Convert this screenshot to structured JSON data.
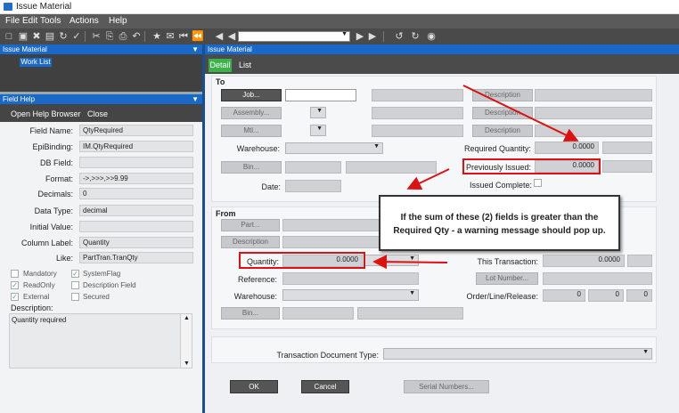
{
  "window": {
    "title": "Issue Material"
  },
  "menu": [
    "File",
    "Edit",
    "Tools",
    "Actions",
    "Help"
  ],
  "panels": {
    "tree_title": "Issue Material",
    "tree_item": "Work List",
    "field_help_title": "Field Help",
    "open_help": "Open Help Browser",
    "close": "Close",
    "right_title": "Issue Material"
  },
  "field_help": {
    "rows": [
      {
        "label": "Field Name:",
        "value": "QtyRequired"
      },
      {
        "label": "EpiBinding:",
        "value": "IM.QtyRequired"
      },
      {
        "label": "DB Field:",
        "value": ""
      },
      {
        "label": "Format:",
        "value": "->,>>>,>>9.99"
      },
      {
        "label": "Decimals:",
        "value": "0"
      },
      {
        "label": "Data Type:",
        "value": "decimal"
      },
      {
        "label": "Initial Value:",
        "value": ""
      },
      {
        "label": "Column Label:",
        "value": "Quantity"
      },
      {
        "label": "Like:",
        "value": "PartTran.TranQty"
      }
    ],
    "checks": [
      {
        "label": "Mandatory",
        "checked": false
      },
      {
        "label": "SystemFlag",
        "checked": true
      },
      {
        "label": "ReadOnly",
        "checked": true
      },
      {
        "label": "Description Field",
        "checked": false
      },
      {
        "label": "External",
        "checked": true
      },
      {
        "label": "Secured",
        "checked": false
      }
    ],
    "description_label": "Description:",
    "description": "Quantity required"
  },
  "tabs": [
    "Detail",
    "List"
  ],
  "to": {
    "title": "To",
    "job": "Job...",
    "assembly": "Assembly...",
    "mtl": "Mtl...",
    "warehouse": "Warehouse:",
    "bin": "Bin...",
    "date": "Date:",
    "description": "Description",
    "required_qty": "Required Quantity:",
    "required_qty_val": "0.0000",
    "prev_issued": "Previously Issued:",
    "prev_issued_val": "0.0000",
    "issued_complete": "Issued Complete:"
  },
  "from": {
    "title": "From",
    "part": "Part...",
    "description": "Description",
    "quantity": "Quantity:",
    "quantity_val": "0.0000",
    "reference": "Reference:",
    "warehouse": "Warehouse:",
    "bin": "Bin...",
    "this_transaction": "This Transaction:",
    "this_transaction_val": "0.0000",
    "lot": "Lot Number...",
    "order_line": "Order/Line/Release:",
    "ol1": "0",
    "ol2": "0",
    "ol3": "0"
  },
  "transaction_doc_type": "Transaction Document Type:",
  "buttons": {
    "ok": "OK",
    "cancel": "Cancel",
    "serial": "Serial Numbers..."
  },
  "callout": "If the sum of these (2) fields is greater than the Required Qty - a warning message should pop up.",
  "colors": {
    "accent": "#1a69c8",
    "annotation": "#dd1111",
    "tab_active": "#3bb24a"
  }
}
